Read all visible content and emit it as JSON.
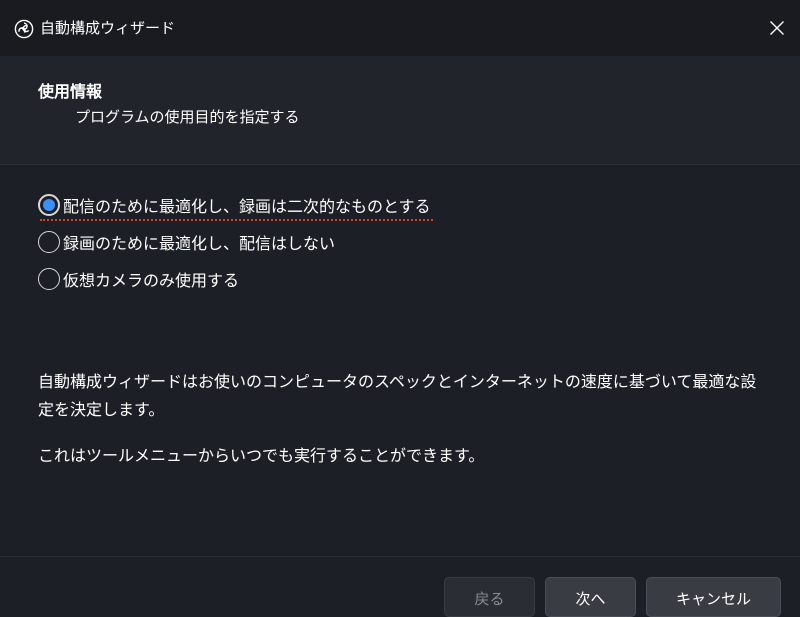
{
  "window": {
    "title": "自動構成ウィザード",
    "app_icon": "obs-logo-icon",
    "close_icon": "close-icon"
  },
  "header": {
    "title": "使用情報",
    "subtitle": "プログラムの使用目的を指定する"
  },
  "options": [
    {
      "label": "配信のために最適化し、録画は二次的なものとする",
      "checked": true
    },
    {
      "label": "録画のために最適化し、配信はしない",
      "checked": false
    },
    {
      "label": "仮想カメラのみ使用する",
      "checked": false
    }
  ],
  "description": {
    "line1": "自動構成ウィザードはお使いのコンピュータのスペックとインターネットの速度に基づいて最適な設定を決定します。",
    "line2": "これはツールメニューからいつでも実行することができます。"
  },
  "buttons": {
    "back": "戻る",
    "next": "次へ",
    "cancel": "キャンセル"
  },
  "colors": {
    "accent": "#3b8ff6",
    "focus_underline": "#d2402e",
    "background": "#1d1f26",
    "header_background": "#22242c"
  }
}
